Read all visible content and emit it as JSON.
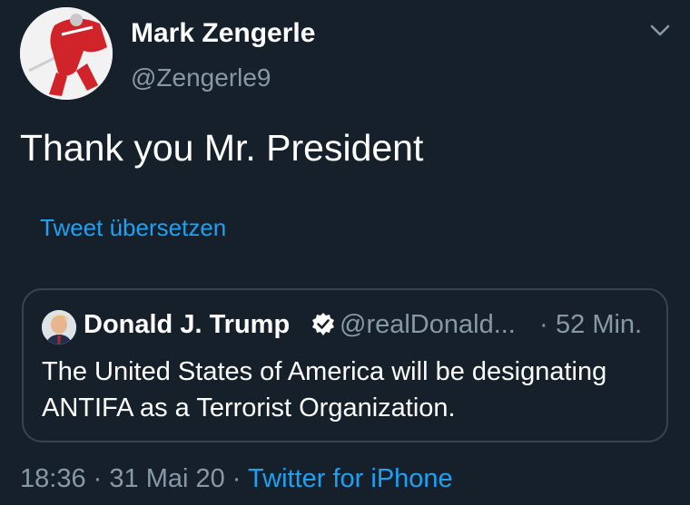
{
  "author": {
    "display_name": "Mark Zengerle",
    "handle": "@Zengerle9",
    "avatar_icon": "hockey-player-avatar"
  },
  "tweet": {
    "text": "Thank you Mr. President",
    "translate_label": "Tweet übersetzen"
  },
  "quoted_tweet": {
    "display_name": "Donald J. Trump",
    "verified_icon": "verified-badge-icon",
    "handle": "@realDonald...",
    "separator": "·",
    "time": "52 Min.",
    "text": "The United States of America will be designating ANTIFA as a Terrorist Organization."
  },
  "meta": {
    "time": "18:36",
    "sep1": "·",
    "date": "31 Mai 20",
    "sep2": "·",
    "source": "Twitter for iPhone"
  },
  "colors": {
    "background": "#15202b",
    "accent": "#1da1f2",
    "secondary_text": "#8899a6",
    "border": "#38444d"
  }
}
